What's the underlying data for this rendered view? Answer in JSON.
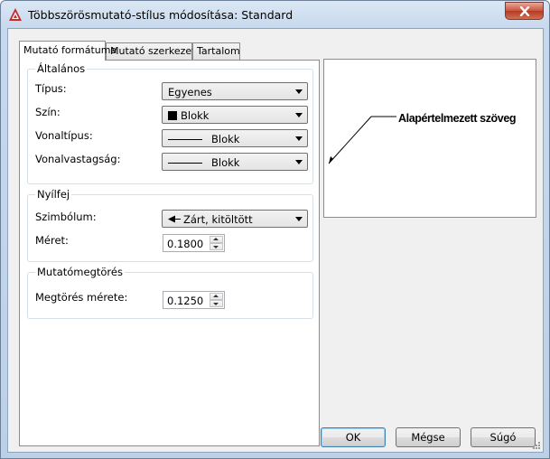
{
  "window": {
    "title": "Többszörösmutató-stílus módosítása: Standard",
    "accent_color": "#c8543c"
  },
  "tabs": [
    {
      "label": "Mutató formátuma",
      "active": true
    },
    {
      "label": "Mutató szerkezete",
      "active": false
    },
    {
      "label": "Tartalom",
      "active": false
    }
  ],
  "general": {
    "title": "Általános",
    "type_label": "Típus:",
    "type_value": "Egyenes",
    "color_label": "Szín:",
    "color_value": "Blokk",
    "linetype_label": "Vonaltípus:",
    "linetype_value": "Blokk",
    "lineweight_label": "Vonalvastagság:",
    "lineweight_value": "Blokk"
  },
  "arrowhead": {
    "title": "Nyílfej",
    "symbol_label": "Szimbólum:",
    "symbol_value": "Zárt, kitöltött",
    "size_label": "Méret:",
    "size_value": "0.1800"
  },
  "leader_break": {
    "title": "Mutatómegtörés",
    "break_size_label": "Megtörés mérete:",
    "break_size_value": "0.1250"
  },
  "preview": {
    "text": "Alapértelmezett szöveg"
  },
  "buttons": {
    "ok": "OK",
    "cancel": "Mégse",
    "help": "Súgó"
  }
}
